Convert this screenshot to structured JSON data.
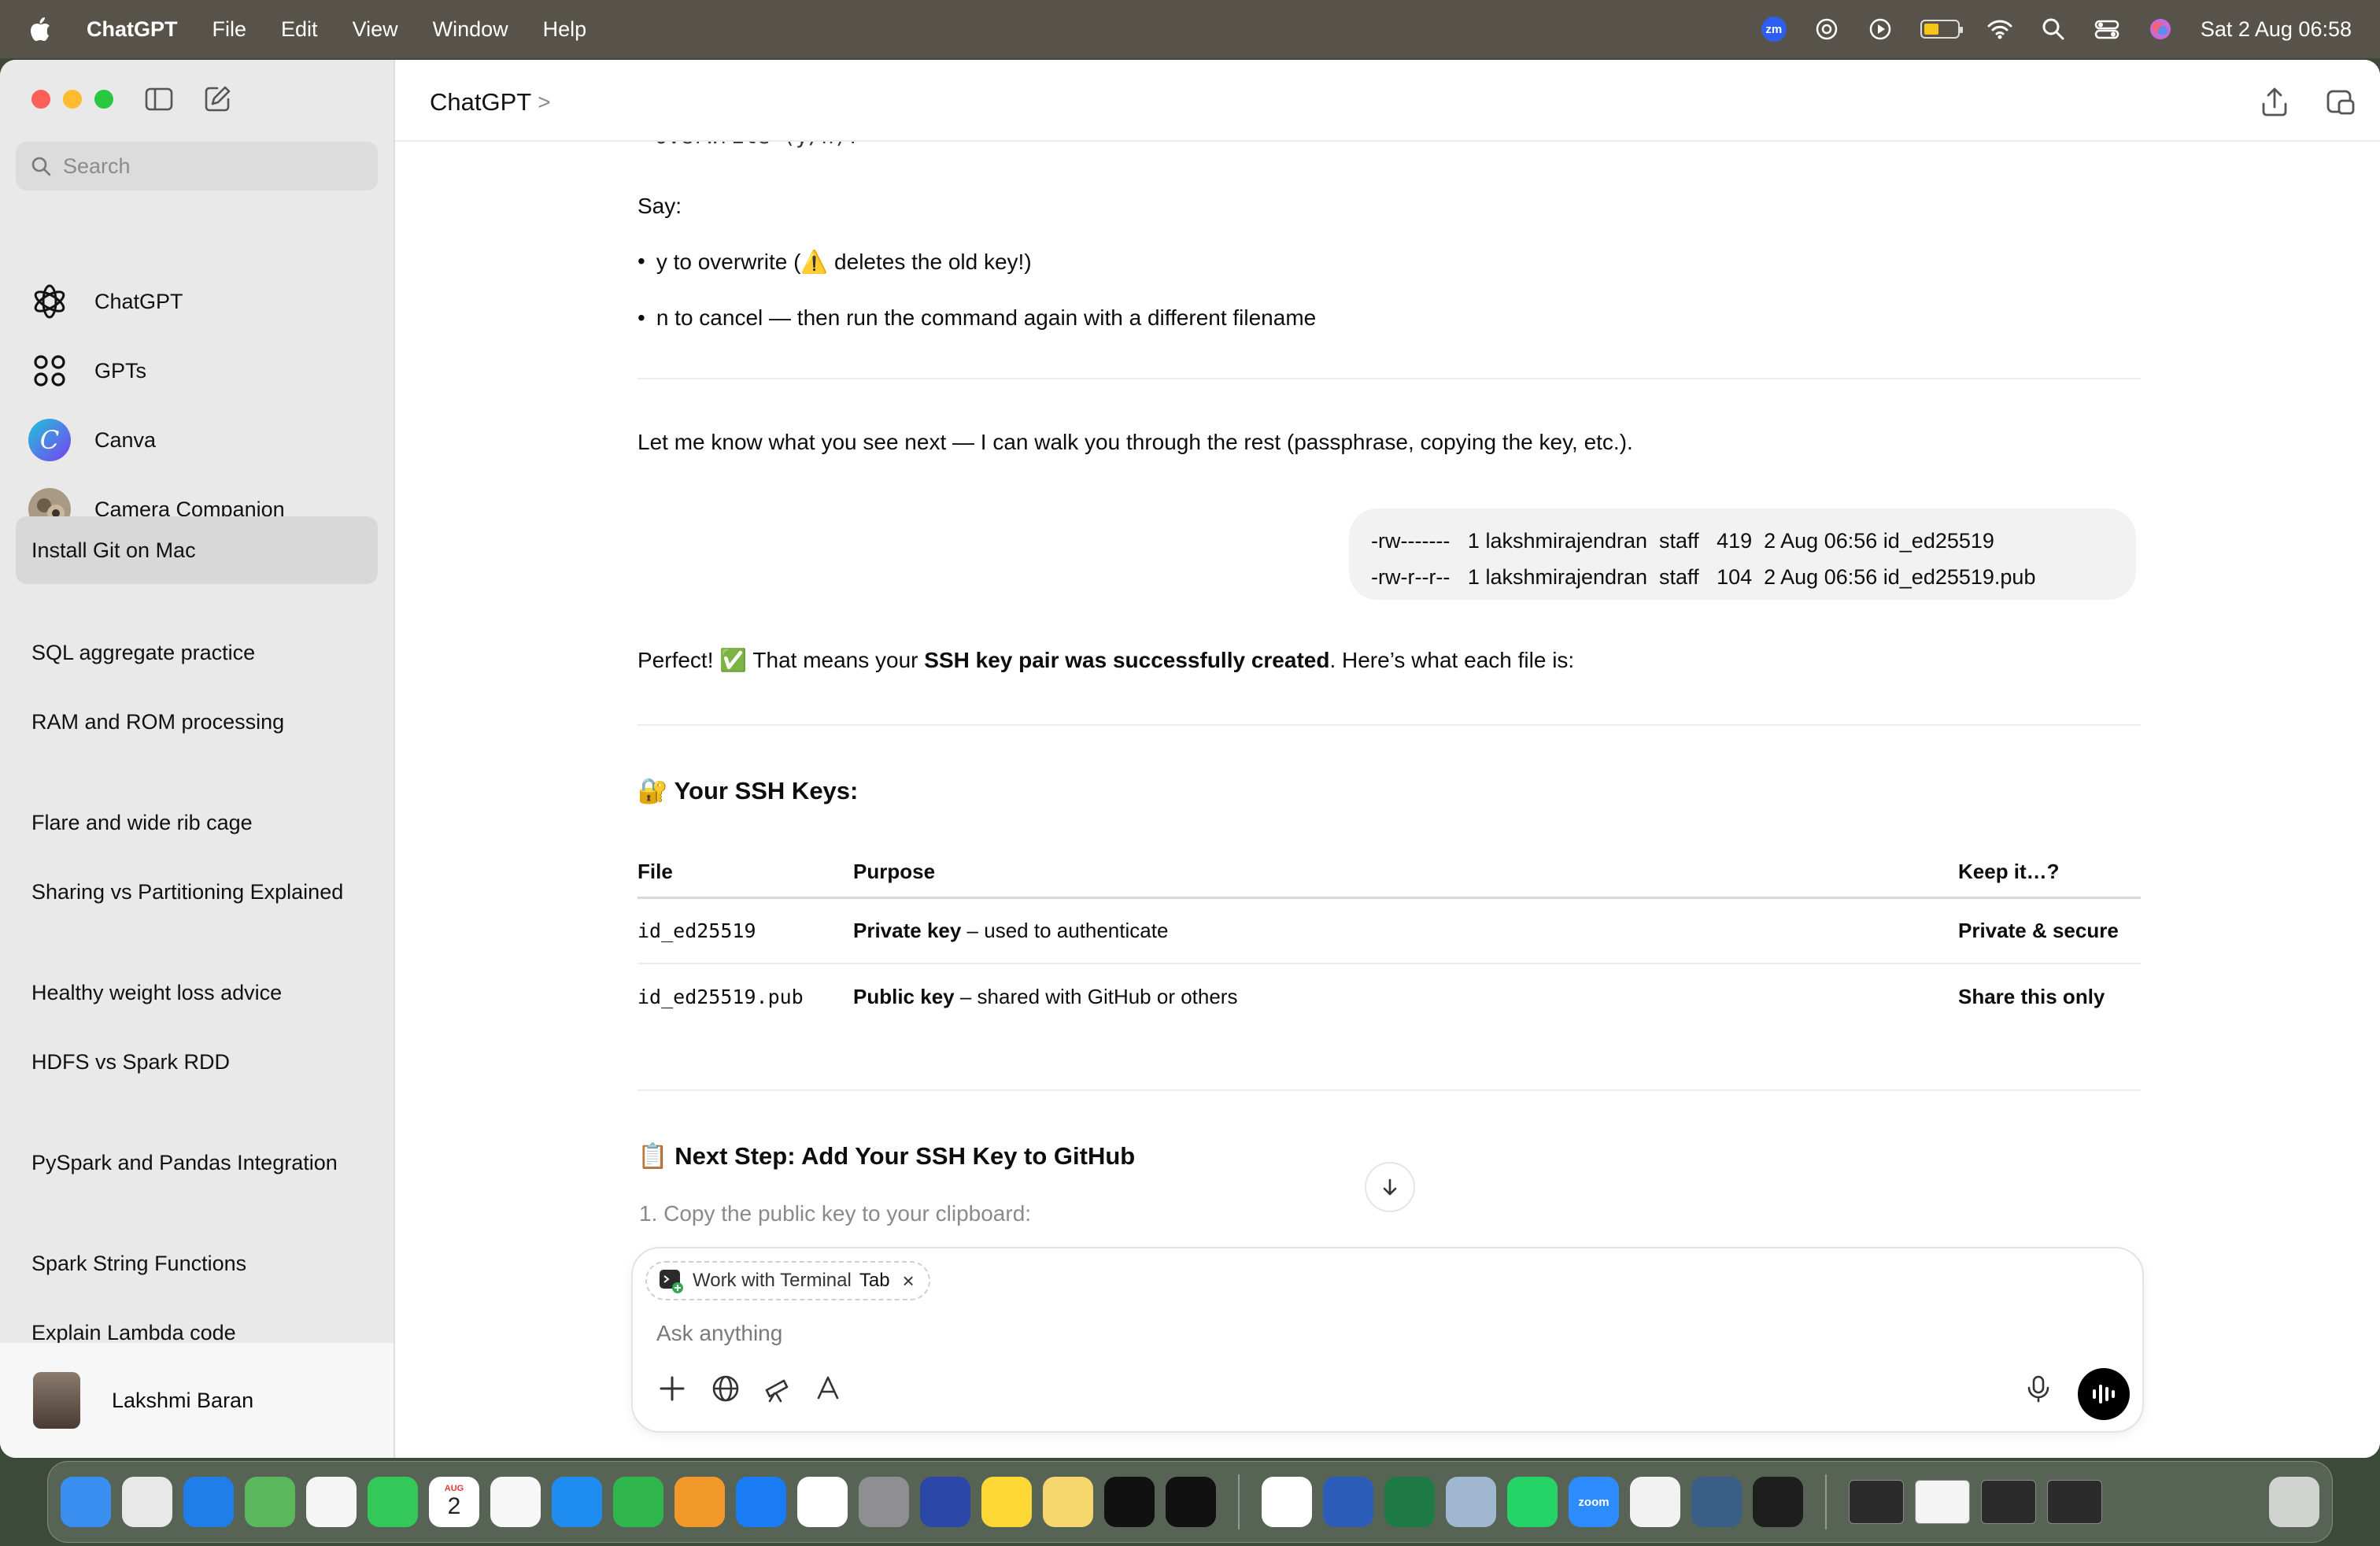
{
  "menubar": {
    "app_name": "ChatGPT",
    "menus": [
      "File",
      "Edit",
      "View",
      "Window",
      "Help"
    ],
    "zoom_badge": "zm",
    "datetime": "Sat 2 Aug  06:58",
    "battery_level": 0.45
  },
  "sidebar": {
    "search_placeholder": "Search",
    "gpts": [
      {
        "label": "ChatGPT",
        "icon": "chatgpt-logo-icon"
      },
      {
        "label": "GPTs",
        "icon": "grid-icon"
      },
      {
        "label": "Canva",
        "icon": "canva-logo-icon"
      },
      {
        "label": "Camera Companion",
        "icon": "camera-companion-icon"
      }
    ],
    "chats": [
      "Install Git on Mac",
      "SQL aggregate practice",
      "RAM and ROM processing",
      "Flare and wide rib cage",
      "Sharing vs Partitioning Explained",
      "Healthy weight loss advice",
      "HDFS vs Spark RDD",
      "PySpark and Pandas Integration",
      "Spark String Functions",
      "Explain Lambda code"
    ],
    "user_name": "Lakshmi Baran"
  },
  "header": {
    "title": "ChatGPT",
    "chevron": ">"
  },
  "conversation": {
    "cut_text": "Overwrite (y/n)?",
    "say_label": "Say:",
    "bullet_1": "y to overwrite (⚠️ deletes the old key!)",
    "bullet_2": "n to cancel — then run the command again with a different filename",
    "let_me_know": "Let me know what you see next — I can walk you through the rest (passphrase, copying the key, etc.).",
    "user_msg_line1": "-rw-------   1 lakshmirajendran  staff   419  2 Aug 06:56 id_ed25519",
    "user_msg_line2": "-rw-r--r--   1 lakshmirajendran  staff   104  2 Aug 06:56 id_ed25519.pub",
    "perfect_pre": "Perfect! ✅ That means your ",
    "perfect_bold": "SSH key pair was successfully created",
    "perfect_post": ". Here’s what each file is:",
    "keys_heading": "🔐 Your SSH Keys:",
    "table_headers": [
      "File",
      "Purpose",
      "Keep it…?"
    ],
    "table_rows": [
      {
        "file": "id_ed25519",
        "purpose_bold": "Private key",
        "purpose_rest": " – used to authenticate",
        "keep": "Private & secure"
      },
      {
        "file": "id_ed25519.pub",
        "purpose_bold": "Public key",
        "purpose_rest": " – shared with GitHub or others",
        "keep": "Share this only"
      }
    ],
    "next_heading": "📋 Next Step: Add Your SSH Key to GitHub",
    "step_1": "1.  Copy the public key to your clipboard:"
  },
  "composer": {
    "chip_label": "Work with Terminal",
    "chip_tab": "Tab",
    "chip_close": "×",
    "placeholder": "Ask anything"
  },
  "dock": {
    "apps": [
      {
        "name": "finder-app",
        "color": "#3a8ef0"
      },
      {
        "name": "launchpad-app",
        "color": "#e8e8e8"
      },
      {
        "name": "safari-app",
        "color": "#1f7ee8"
      },
      {
        "name": "maps-app",
        "color": "#5cb85c"
      },
      {
        "name": "photos-app",
        "color": "#f5f5f5"
      },
      {
        "name": "facetime-app",
        "color": "#34c759"
      },
      {
        "name": "calendar-app",
        "color": "#ffffff"
      },
      {
        "name": "freeform-app",
        "color": "#f7f7f7"
      },
      {
        "name": "keynote-app",
        "color": "#1e8cf0"
      },
      {
        "name": "numbers-app",
        "color": "#2fb64d"
      },
      {
        "name": "pages-app",
        "color": "#f29a29"
      },
      {
        "name": "app-store-app",
        "color": "#1a7cf5"
      },
      {
        "name": "chrome-app",
        "color": "#ffffff"
      },
      {
        "name": "system-settings-app",
        "color": "#8e8e93"
      },
      {
        "name": "screen-capture-app",
        "color": "#2b47a8"
      },
      {
        "name": "notes-app",
        "color": "#fdd835"
      },
      {
        "name": "stickies-app",
        "color": "#f5d76e"
      },
      {
        "name": "intellij-app",
        "color": "#111111"
      },
      {
        "name": "pycharm-app",
        "color": "#111111"
      },
      {
        "name": "chatgpt-app",
        "color": "#ffffff"
      },
      {
        "name": "word-app",
        "color": "#2b5cb8"
      },
      {
        "name": "excel-app",
        "color": "#1d7a45"
      },
      {
        "name": "preview-app",
        "color": "#9fb7cf"
      },
      {
        "name": "whatsapp-app",
        "color": "#25d366"
      },
      {
        "name": "zoom-app",
        "color": "#2d8cff"
      },
      {
        "name": "textedit-app",
        "color": "#f2f2f2"
      },
      {
        "name": "mysql-workbench-app",
        "color": "#3a5f86"
      },
      {
        "name": "terminal-app",
        "color": "#1e1e1e"
      }
    ],
    "calendar_month": "AUG",
    "calendar_day": "2",
    "zoom_label": "zoom",
    "calendar_color": "#e53935"
  },
  "colors": {
    "sidebar_bg": "#e9e9e9",
    "user_bubble": "#f2f2f2",
    "menubar_bg": "#58534a",
    "accent_black": "#000000"
  }
}
